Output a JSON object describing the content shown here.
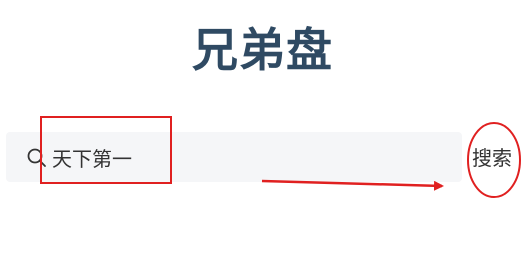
{
  "page": {
    "title": "兄弟盘"
  },
  "search": {
    "value": "天下第一",
    "button_label": "搜索",
    "icon": "search-icon"
  },
  "annotations": {
    "color": "#e02020",
    "items": [
      "input-highlight-box",
      "arrow-to-button",
      "button-highlight-ellipse"
    ]
  },
  "colors": {
    "title": "#2f4a63",
    "search_bar_bg": "#f5f6f8",
    "text": "#333333"
  }
}
